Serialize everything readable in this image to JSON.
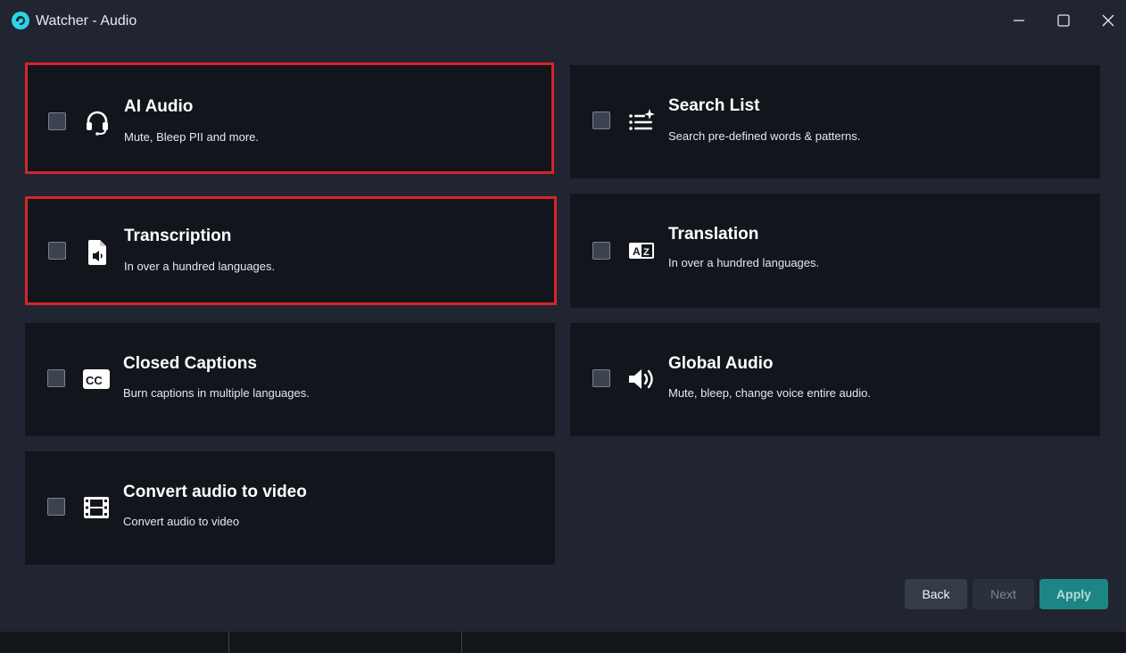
{
  "window": {
    "title": "Watcher - Audio",
    "controls": [
      "minimize-icon",
      "maximize-icon",
      "close-icon"
    ]
  },
  "options": {
    "ai_audio": {
      "title": "AI Audio",
      "desc": "Mute, Bleep PII and more.",
      "icon": "headset-icon",
      "checked": false,
      "highlighted": true
    },
    "search_list": {
      "title": "Search List",
      "desc": "Search pre-defined words & patterns.",
      "icon": "list-sparkle-icon",
      "checked": false,
      "highlighted": false
    },
    "transcription": {
      "title": "Transcription",
      "desc": "In over a hundred languages.",
      "icon": "audio-file-icon",
      "checked": false,
      "highlighted": true
    },
    "translation": {
      "title": "Translation",
      "desc": "In over a hundred languages.",
      "icon": "translate-icon",
      "checked": false,
      "highlighted": false
    },
    "closed_captions": {
      "title": "Closed Captions",
      "desc": "Burn captions in multiple languages.",
      "icon": "cc-icon",
      "checked": false,
      "highlighted": false
    },
    "global_audio": {
      "title": "Global Audio",
      "desc": "Mute, bleep, change voice entire audio.",
      "icon": "speaker-icon",
      "checked": false,
      "highlighted": false
    },
    "convert_audio": {
      "title": "Convert audio to video",
      "desc": "Convert audio to video",
      "icon": "film-icon",
      "checked": false,
      "highlighted": false
    }
  },
  "buttons": {
    "back": "Back",
    "next": "Next",
    "apply": "Apply"
  },
  "colors": {
    "background": "#202531",
    "card": "#12151b",
    "highlight": "#d4262a",
    "accent": "#1e8585",
    "app_icon": "#2fd2e6"
  }
}
